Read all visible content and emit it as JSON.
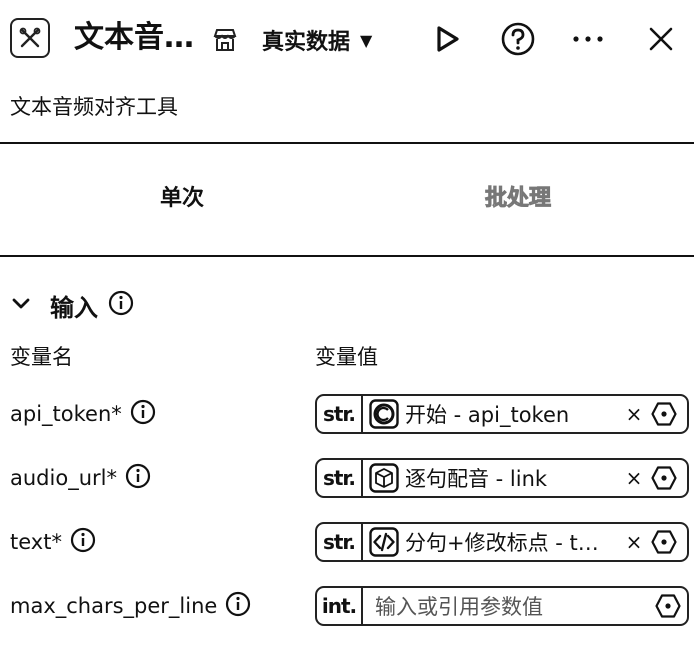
{
  "header": {
    "title": "文本音…",
    "data_mode": "真实数据",
    "caret": "▼",
    "more": "···"
  },
  "subtitle": "文本音频对齐工具",
  "tabs": [
    {
      "label": "单次",
      "active": true
    },
    {
      "label": "批处理",
      "active": false
    }
  ],
  "inputs_section": {
    "title": "输入",
    "col_name": "变量名",
    "col_value": "变量值",
    "rows": [
      {
        "name": "api_token*",
        "type": "str.",
        "ref_icon": "start-node-icon",
        "value": "开始 - api_token",
        "clear": "×"
      },
      {
        "name": "audio_url*",
        "type": "str.",
        "ref_icon": "cube-node-icon",
        "value": "逐句配音 - link",
        "clear": "×"
      },
      {
        "name": "text*",
        "type": "str.",
        "ref_icon": "code-node-icon",
        "value": "分句+修改标点 - t…",
        "clear": "×"
      },
      {
        "name": "max_chars_per_line",
        "type": "int.",
        "placeholder": "输入或引用参数值"
      }
    ]
  }
}
